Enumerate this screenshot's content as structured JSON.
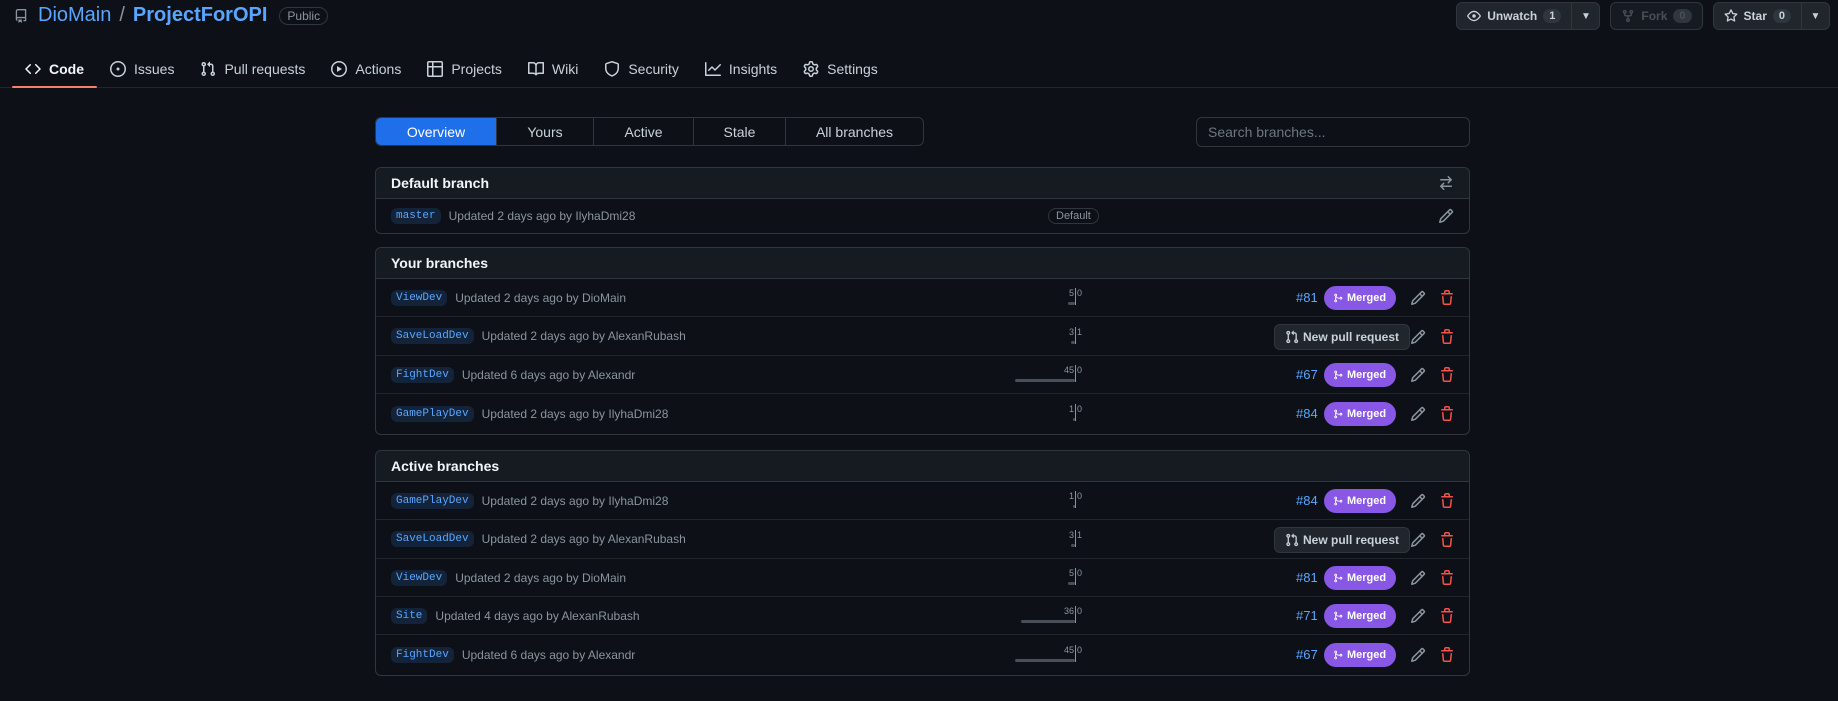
{
  "repo": {
    "owner": "DioMain",
    "separator": "/",
    "name": "ProjectForOPI",
    "visibility": "Public"
  },
  "actions": {
    "watch": {
      "label": "Unwatch",
      "count": "1"
    },
    "fork": {
      "label": "Fork",
      "count": "0"
    },
    "star": {
      "label": "Star",
      "count": "0"
    }
  },
  "nav": [
    {
      "label": "Code",
      "icon": "code-icon"
    },
    {
      "label": "Issues",
      "icon": "issue-opened-icon"
    },
    {
      "label": "Pull requests",
      "icon": "git-pull-request-icon"
    },
    {
      "label": "Actions",
      "icon": "play-icon"
    },
    {
      "label": "Projects",
      "icon": "table-icon"
    },
    {
      "label": "Wiki",
      "icon": "book-icon"
    },
    {
      "label": "Security",
      "icon": "shield-icon"
    },
    {
      "label": "Insights",
      "icon": "graph-icon"
    },
    {
      "label": "Settings",
      "icon": "gear-icon"
    }
  ],
  "subnav": [
    "Overview",
    "Yours",
    "Active",
    "Stale",
    "All branches"
  ],
  "search": {
    "placeholder": "Search branches..."
  },
  "default_section": {
    "title": "Default branch",
    "branch": {
      "name": "master",
      "updated": "Updated 2 days ago by IlyhaDmi28",
      "badge": "Default"
    }
  },
  "your_section": {
    "title": "Your branches",
    "branches": [
      {
        "name": "ViewDev",
        "updated": "Updated 2 days ago by DioMain",
        "behind": "5",
        "ahead": "0",
        "pr": "#81",
        "status": "Merged"
      },
      {
        "name": "SaveLoadDev",
        "updated": "Updated 2 days ago by AlexanRubash",
        "behind": "3",
        "ahead": "1",
        "new_pr": "New pull request"
      },
      {
        "name": "FightDev",
        "updated": "Updated 6 days ago by Alexandr",
        "behind": "45",
        "ahead": "0",
        "pr": "#67",
        "status": "Merged"
      },
      {
        "name": "GamePlayDev",
        "updated": "Updated 2 days ago by IlyhaDmi28",
        "behind": "1",
        "ahead": "0",
        "pr": "#84",
        "status": "Merged"
      }
    ]
  },
  "active_section": {
    "title": "Active branches",
    "branches": [
      {
        "name": "GamePlayDev",
        "updated": "Updated 2 days ago by IlyhaDmi28",
        "behind": "1",
        "ahead": "0",
        "pr": "#84",
        "status": "Merged"
      },
      {
        "name": "SaveLoadDev",
        "updated": "Updated 2 days ago by AlexanRubash",
        "behind": "3",
        "ahead": "1",
        "new_pr": "New pull request"
      },
      {
        "name": "ViewDev",
        "updated": "Updated 2 days ago by DioMain",
        "behind": "5",
        "ahead": "0",
        "pr": "#81",
        "status": "Merged"
      },
      {
        "name": "Site",
        "updated": "Updated 4 days ago by AlexanRubash",
        "behind": "36",
        "ahead": "0",
        "pr": "#71",
        "status": "Merged"
      },
      {
        "name": "FightDev",
        "updated": "Updated 6 days ago by Alexandr",
        "behind": "45",
        "ahead": "0",
        "pr": "#67",
        "status": "Merged"
      }
    ]
  },
  "colors": {
    "accent": "#1f6feb",
    "link": "#58a6ff",
    "merged": "#8957e5",
    "danger": "#f85149",
    "background": "#0d1117"
  }
}
